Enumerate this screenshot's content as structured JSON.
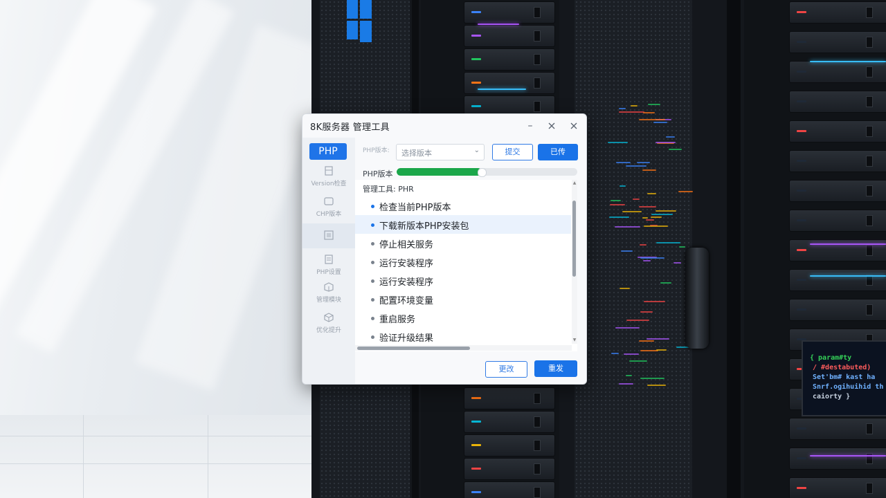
{
  "dialog": {
    "title": "8K服务器   管理工具",
    "controls": {
      "minimize": "–",
      "maximize": "☐",
      "close": "✕"
    }
  },
  "sidebar": {
    "php_label": "PHP",
    "items": [
      {
        "label": "Version检查",
        "icon": "server-icon"
      },
      {
        "label": "CHP版本",
        "icon": "window-icon"
      },
      {
        "label": "",
        "icon": "panel-icon"
      },
      {
        "label": "PHP设置",
        "icon": "document-icon"
      },
      {
        "label": "管理模块",
        "icon": "package-icon"
      },
      {
        "label": "优化提升",
        "icon": "cube-icon"
      }
    ]
  },
  "toolbar": {
    "version_label": "PHP版本:",
    "version_select": "选择版本",
    "button_outline": "提交",
    "button_fill": "已传"
  },
  "progress": {
    "label": "PHP版本",
    "value": 0.47,
    "color": "#1aa64a"
  },
  "panel": {
    "heading": "管理工具: PHR",
    "steps": [
      "检查当前PHP版本",
      "下载新版本PHP安装包",
      "停止相关服务",
      "运行安装程序",
      "运行安装程序",
      "配置环境变量",
      "重启服务",
      "验证升级结果"
    ],
    "highlighted_step": 1
  },
  "footer": {
    "secondary": "更改",
    "primary": "重发"
  },
  "background": {
    "screen_lines": [
      "{ param#ty",
      "  / #destabuted)",
      "Set'bm# kast ha",
      "Snrf.ogihuihid th",
      "caiorty }"
    ]
  },
  "colors": {
    "accent": "#1a73e8",
    "progress": "#1aa64a",
    "windows_logo": "#1a7be6"
  }
}
